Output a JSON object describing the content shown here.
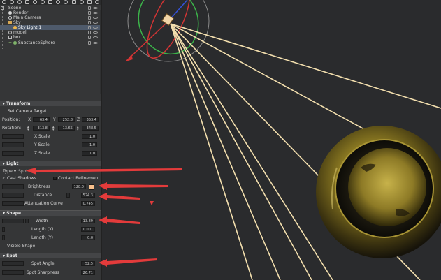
{
  "hierarchy": {
    "items": [
      {
        "label": "Scene"
      },
      {
        "label": "Render"
      },
      {
        "label": "Main Camera"
      },
      {
        "label": "Sky"
      },
      {
        "label": "Sky Light 1"
      },
      {
        "label": "model"
      },
      {
        "label": "box"
      },
      {
        "label": "SubstanceSphere"
      }
    ]
  },
  "transform": {
    "title": "Transform",
    "set_camera_target": "Set Camera Target",
    "position_label": "Position:",
    "rotation_label": "Rotation:",
    "x": "X",
    "y": "Y",
    "z": "Z",
    "position": {
      "x": "63.4",
      "y": "252.8",
      "z": "353.4"
    },
    "rotation": {
      "x": "313.8",
      "y": "13.65",
      "z": "348.5"
    },
    "x_scale_label": "X Scale",
    "x_scale": "1.0",
    "y_scale_label": "Y Scale",
    "y_scale": "1.0",
    "z_scale_label": "Z Scale",
    "z_scale": "1.0"
  },
  "light": {
    "title": "Light",
    "type_label": "Type",
    "type_value": "Spot",
    "cast_shadows": "Cast Shadows",
    "contact_refinement": "Contact Refinement",
    "brightness_label": "Brightness",
    "brightness": "128.0",
    "distance_label": "Distance",
    "distance": "524.3",
    "attenuation_label": "Attenuation Curve",
    "attenuation": "0.745",
    "color": "#f8c08c"
  },
  "shape": {
    "title": "Shape",
    "width_label": "Width",
    "width": "13.89",
    "length_x_label": "Length (X)",
    "length_x": "0.001",
    "length_y_label": "Length (Y)",
    "length_y": "0.0",
    "visible_shape": "Visible Shape"
  },
  "spot": {
    "title": "Spot",
    "spot_angle_label": "Spot Angle",
    "spot_angle": "52.5",
    "spot_sharpness_label": "Spot Sharpness",
    "spot_sharpness": "26.71"
  },
  "colors": {
    "annotation_arrow": "#e33b3b",
    "beam": "#f3dfae",
    "selection": "#4e5a6b"
  }
}
